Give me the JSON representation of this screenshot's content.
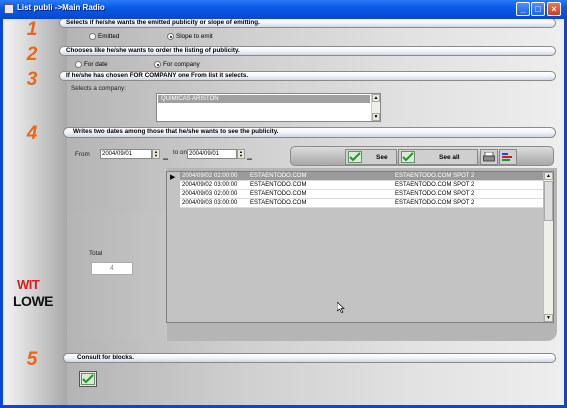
{
  "window": {
    "title": "List publi ->Main Radio",
    "controls": {
      "minimize": "_",
      "maximize": "□",
      "close": "×"
    }
  },
  "sidebar": {
    "step_numbers": [
      "1",
      "2",
      "3",
      "4",
      "5"
    ],
    "logo_line1": "WIT",
    "logo_line2": "LOWE"
  },
  "section1": {
    "header": "Selects if he/she wants the emitted publicity or slope of emitting.",
    "options": [
      {
        "label": "Emitted",
        "selected": false
      },
      {
        "label": "Slope to emit",
        "selected": true
      }
    ]
  },
  "section2": {
    "header": "Chooses like he/she wants to order the listing of publicity.",
    "options": [
      {
        "label": "For date",
        "selected": false
      },
      {
        "label": "For company",
        "selected": true
      }
    ]
  },
  "section3": {
    "header": "If he/she has chosen FOR COMPANY one From list it selects.",
    "company_label": "Selects a company:",
    "companies": [
      "QUIMICAS ARISTON"
    ]
  },
  "section4": {
    "header": "Writes two dates among those that he/she wants to see the publicity.",
    "from_label": "From",
    "from_value": "2004/09/01",
    "to_label": "to one",
    "to_value": "2004/09/01",
    "see_label": "See",
    "see_all_label": "See all",
    "total_label": "Total",
    "total_value": "4",
    "rows": [
      {
        "date": "2004/09/02",
        "time": "02:00:00",
        "site": "ESTAENTODO.COM",
        "spot": "ESTAENTODO.COM SPOT 2"
      },
      {
        "date": "2004/09/02",
        "time": "03:00:00",
        "site": "ESTAENTODO.COM",
        "spot": "ESTAENTODO.COM SPOT 2"
      },
      {
        "date": "2004/09/03",
        "time": "02:00:00",
        "site": "ESTAENTODO.COM",
        "spot": "ESTAENTODO.COM SPOT 2"
      },
      {
        "date": "2004/09/03",
        "time": "03:00:00",
        "site": "ESTAENTODO.COM",
        "spot": "ESTAENTODO.COM SPOT 2"
      }
    ]
  },
  "section5": {
    "header": "Consult for blocks."
  },
  "colors": {
    "step_number": "#e8671a",
    "logo_red": "#d42020",
    "title_bar": "#0a5ae8"
  }
}
